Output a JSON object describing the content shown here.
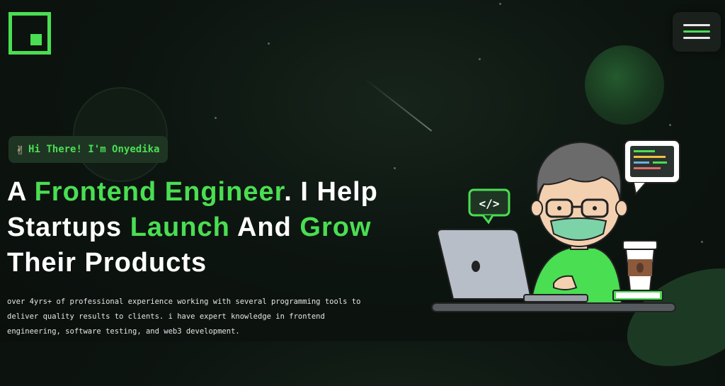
{
  "header": {
    "logo_icon": "square-bracket-logo-icon",
    "menu_icon": "hamburger-menu-icon"
  },
  "hero": {
    "greeting": {
      "icon": "victory-hand-icon",
      "text": "Hi There! I'm Onyedika"
    },
    "headline": {
      "part1": "A ",
      "part2": "Frontend Engineer",
      "part3": ". I Help",
      "part4": "Startups ",
      "part5": "Launch",
      "part6": " And ",
      "part7": "Grow",
      "part8": "Their Products"
    },
    "bio": "over 4yrs+ of professional experience working with several programming tools to deliver quality results to clients. i have expert knowledge in frontend engineering, software testing, and web3 development.",
    "illustration_icons": [
      "code-bubble-icon",
      "monitor-bubble-icon",
      "laptop-icon",
      "coffee-cup-icon"
    ]
  },
  "colors": {
    "accent": "#4ade52",
    "background": "#0d1510",
    "text": "#ffffff"
  }
}
